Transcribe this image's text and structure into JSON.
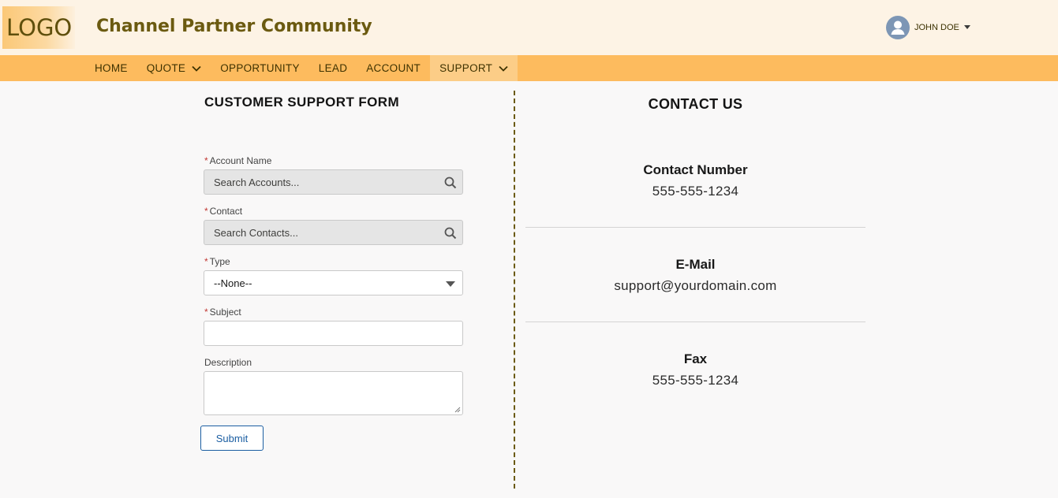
{
  "header": {
    "logo": "LOGO",
    "title": "Channel Partner Community",
    "user_name": "JOHN DOE"
  },
  "nav": {
    "items": [
      {
        "label": "HOME",
        "dropdown": false,
        "active": false
      },
      {
        "label": "QUOTE",
        "dropdown": true,
        "active": false
      },
      {
        "label": "OPPORTUNITY",
        "dropdown": false,
        "active": false
      },
      {
        "label": "LEAD",
        "dropdown": false,
        "active": false
      },
      {
        "label": "ACCOUNT",
        "dropdown": false,
        "active": false
      },
      {
        "label": "SUPPORT",
        "dropdown": true,
        "active": true
      }
    ]
  },
  "form": {
    "title": "CUSTOMER SUPPORT FORM",
    "required_marker": "*",
    "account_label": "Account Name",
    "account_placeholder": "Search Accounts...",
    "contact_label": "Contact",
    "contact_placeholder": "Search Contacts...",
    "type_label": "Type",
    "type_value": "--None--",
    "subject_label": "Subject",
    "subject_value": "",
    "description_label": "Description",
    "description_value": "",
    "submit_label": "Submit"
  },
  "contact": {
    "title": "CONTACT US",
    "number_heading": "Contact Number",
    "number_value": "555-555-1234",
    "email_heading": "E-Mail",
    "email_value": "support@yourdomain.com",
    "fax_heading": "Fax",
    "fax_value": "555-555-1234"
  },
  "colors": {
    "header_bg": "#fdf3e5",
    "nav_bg": "#fdbb5e",
    "nav_active_bg": "#fccd87",
    "brand_text": "#6b5a10",
    "required": "#c23934",
    "button_blue": "#1b5ea2"
  }
}
